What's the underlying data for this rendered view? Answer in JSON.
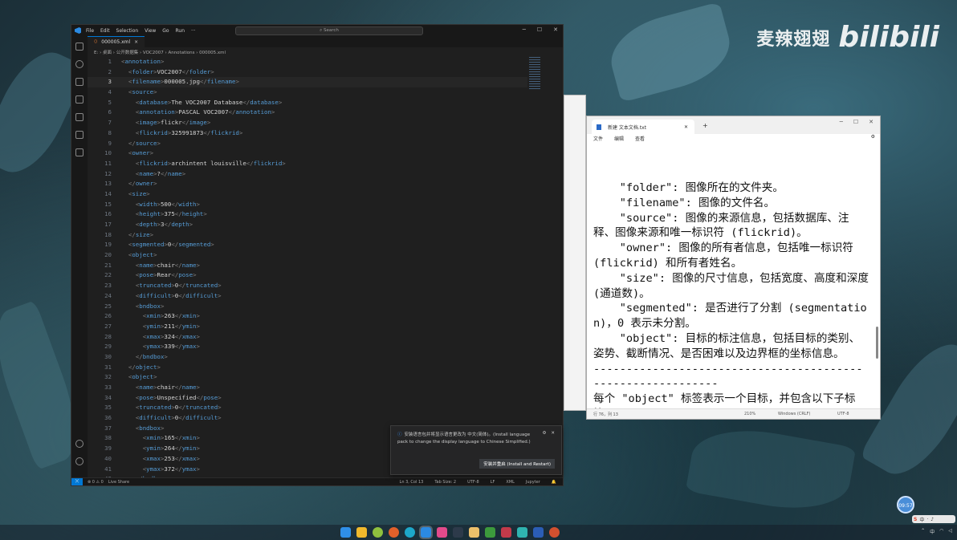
{
  "watermark": {
    "name": "麦辣翅翅",
    "brand": "bilibili"
  },
  "vscode": {
    "menu": [
      "File",
      "Edit",
      "Selection",
      "View",
      "Go",
      "Run",
      "···"
    ],
    "search_placeholder": "Search",
    "tab": {
      "label": "000005.xml",
      "close": "×"
    },
    "breadcrumb": "E: › 桌面 › 公开数据集 › VOC2007 › Annotations › 000005.xml",
    "lines": [
      "<annotation>",
      "  <folder>VOC2007</folder>",
      "  <filename>000005.jpg</filename>",
      "  <source>",
      "    <database>The VOC2007 Database</database>",
      "    <annotation>PASCAL VOC2007</annotation>",
      "    <image>flickr</image>",
      "    <flickrid>325991873</flickrid>",
      "  </source>",
      "  <owner>",
      "    <flickrid>archintent louisville</flickrid>",
      "    <name>?</name>",
      "  </owner>",
      "  <size>",
      "    <width>500</width>",
      "    <height>375</height>",
      "    <depth>3</depth>",
      "  </size>",
      "  <segmented>0</segmented>",
      "  <object>",
      "    <name>chair</name>",
      "    <pose>Rear</pose>",
      "    <truncated>0</truncated>",
      "    <difficult>0</difficult>",
      "    <bndbox>",
      "      <xmin>263</xmin>",
      "      <ymin>211</ymin>",
      "      <xmax>324</xmax>",
      "      <ymax>339</ymax>",
      "    </bndbox>",
      "  </object>",
      "  <object>",
      "    <name>chair</name>",
      "    <pose>Unspecified</pose>",
      "    <truncated>0</truncated>",
      "    <difficult>0</difficult>",
      "    <bndbox>",
      "      <xmin>165</xmin>",
      "      <ymin>264</ymin>",
      "      <xmax>253</xmax>",
      "      <ymax>372</ymax>",
      "    </bndbox>"
    ],
    "current_line": 3,
    "notification": {
      "text": "安装语言包并将显示语言更改为 中文(简体)。(Install language pack to change the display language to Chinese Simplified.)",
      "button": "安装并重启 (Install and Restart)"
    },
    "status": {
      "errors": "⊗ 0 ⚠ 0",
      "live_share": "Live Share",
      "position": "Ln 3, Col 13",
      "tab_size": "Tab Size: 2",
      "encoding": "UTF-8",
      "eol": "LF",
      "language": "XML",
      "jupyter": "Jupyter"
    }
  },
  "notepad": {
    "tab_label": "新建 文本文档.txt",
    "menu": [
      "文件",
      "编辑",
      "查看"
    ],
    "content": "    \"folder\": 图像所在的文件夹。\n    \"filename\": 图像的文件名。\n    \"source\": 图像的来源信息，包括数据库、注释、图像来源和唯一标识符 (flickrid)。\n    \"owner\": 图像的所有者信息，包括唯一标识符 (flickrid) 和所有者姓名。\n    \"size\": 图像的尺寸信息，包括宽度、高度和深度 (通道数)。\n    \"segmented\": 是否进行了分割 (segmentation)，0 表示未分割。\n    \"object\": 目标的标注信息，包括目标的类别、姿势、截断情况、是否困难以及边界框的坐标信息。\n------------------------------------------------------------\n每个 \"object\" 标签表示一个目标，并包含以下子标签：",
    "status": {
      "position": "行 76，列 13",
      "zoom": "210%",
      "eol": "Windows (CRLF)",
      "encoding": "UTF-8"
    }
  },
  "taskbar": {
    "clock": "09:57",
    "tray": "中"
  }
}
